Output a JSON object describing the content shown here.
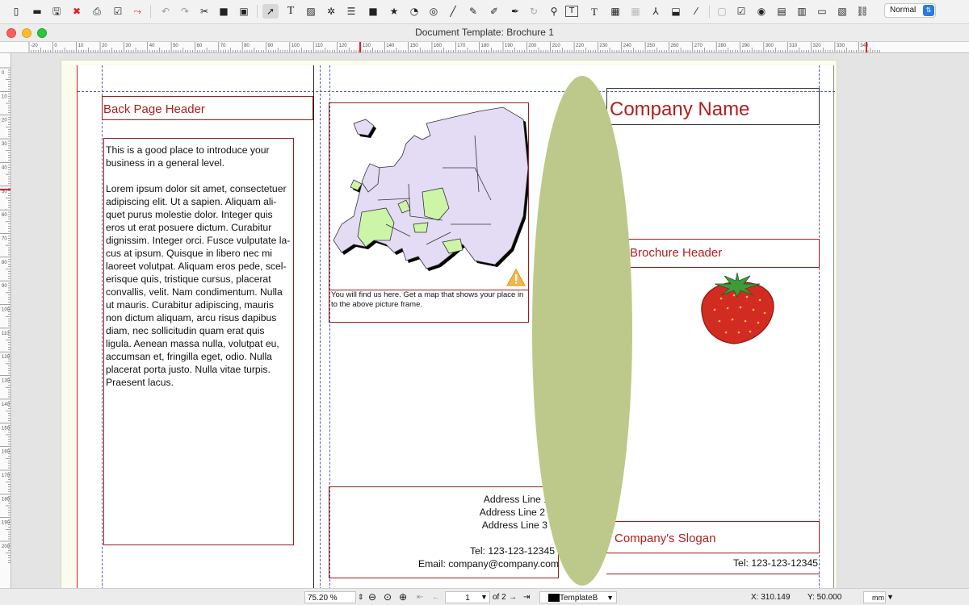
{
  "toolbar": {
    "icons": [
      "new-document-icon",
      "open-icon",
      "save-icon",
      "close-icon",
      "print-icon",
      "preflight-icon",
      "export-pdf-icon",
      "undo-icon",
      "redo-icon",
      "cut-icon",
      "copy-icon",
      "paste-icon",
      "select-icon",
      "text-frame-icon",
      "image-frame-icon",
      "render-frame-icon",
      "table-icon",
      "shape-icon",
      "polygon-icon",
      "arc-icon",
      "spiral-icon",
      "line-icon",
      "bezier-icon",
      "freehand-icon",
      "rotate-icon",
      "zoom-icon",
      "edit-content-icon",
      "edit-text-icon",
      "link-frames-icon",
      "unlink-frames-icon",
      "measure-icon",
      "copy-properties-icon",
      "eyedropper-icon",
      "pdf-push-button-icon",
      "pdf-checkbox-icon",
      "pdf-radio-icon",
      "pdf-combo-icon",
      "pdf-list-icon",
      "pdf-text-field-icon",
      "pdf-link-icon"
    ],
    "mode": "Normal"
  },
  "window": {
    "title": "Document Template: Brochure 1"
  },
  "ruler": {
    "h_labels": [
      "-20",
      "0",
      "10",
      "20",
      "30",
      "40",
      "50",
      "60",
      "70",
      "80",
      "90",
      "100",
      "110",
      "120",
      "130",
      "140",
      "150",
      "160",
      "170",
      "180",
      "190",
      "200",
      "210",
      "220",
      "230",
      "240",
      "250",
      "260",
      "270",
      "280",
      "290",
      "300",
      "310",
      "320",
      "330",
      "340"
    ],
    "v_labels": [
      "0",
      "10",
      "20",
      "30",
      "40",
      "50",
      "60",
      "70",
      "80",
      "90",
      "100",
      "110",
      "120",
      "130",
      "140",
      "150",
      "160",
      "170",
      "180",
      "190",
      "200"
    ]
  },
  "page": {
    "back_header": "Back Page Header",
    "intro": "This is a good place to introduce your business in a general level.",
    "lorem": "Lorem ipsum dolor sit amet, consectetuer adipiscing elit. Ut a sapien. Aliquam ali-quet purus molestie dolor. Integer quis eros ut erat posuere dictum. Curabitur dignissim. Integer orci. Fusce vulputate la-cus at ipsum. Quisque in libero nec mi laoreet volutpat. Aliquam eros pede, scel-erisque quis, tristique cursus, placerat convallis, velit. Nam condimentum. Nulla ut mauris. Curabitur adipiscing, mauris non dictum aliquam, arcu risus dapibus diam, nec sollicitudin quam erat quis ligula. Aenean massa nulla, volutpat eu, accumsan et, fringilla eget, odio. Nulla placerat porta justo. Nulla vitae turpis. Praesent lacus.",
    "map_caption": "You will find us here. Get a map that shows your place in to the above picture frame.",
    "address": {
      "line1": "Address Line 1",
      "line2": "Address Line 2",
      "line3": "Address Line 3",
      "tel": "Tel: 123-123-12345",
      "email": "Email: company@company.com"
    },
    "company_name": "Company Name",
    "brochure_header": "Brochure Header",
    "slogan": "Company's Slogan",
    "tel_right": "Tel: 123-123-12345",
    "colors": {
      "heading_red": "#b0201c",
      "ellipse_fill": "#bcc98a",
      "map_land": "#e4dcf4",
      "map_highlight": "#ccf5a8"
    }
  },
  "status": {
    "zoom": "75.20 %",
    "page_current": "1",
    "page_of": "of 2",
    "layer": "TemplateB",
    "x_readout": "X:  310.149",
    "y_readout": "Y:  50.000",
    "unit": "mm"
  }
}
